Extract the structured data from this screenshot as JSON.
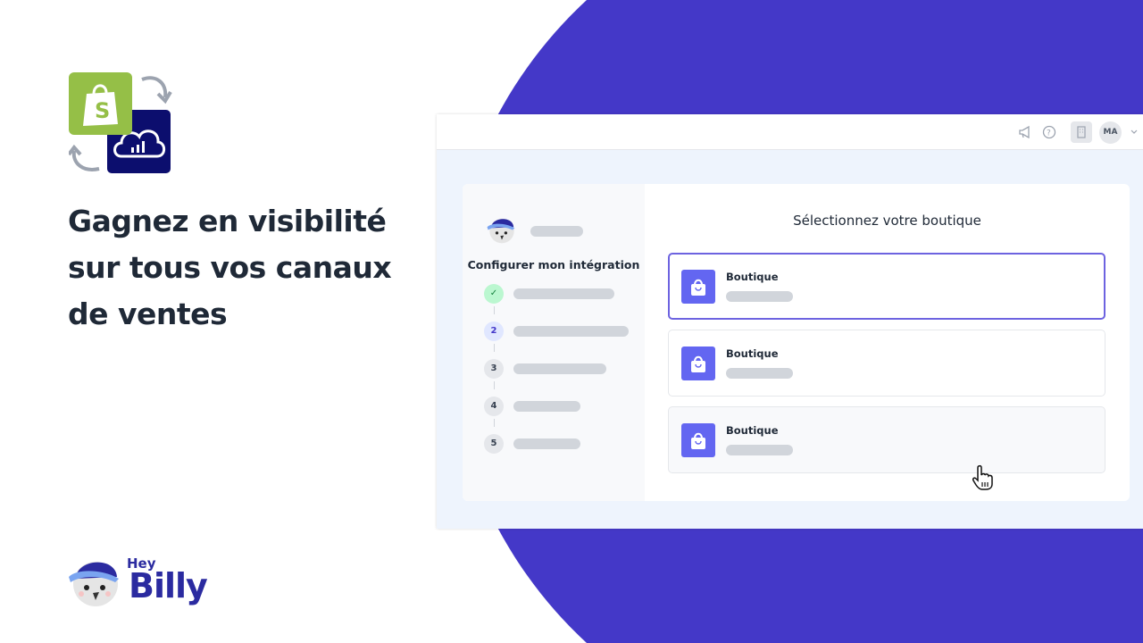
{
  "headline": {
    "line1": "Gagnez en visibilité",
    "line2": "sur tous vos canaux",
    "line3": "de ventes"
  },
  "brand": {
    "hey": "Hey",
    "billy": "Billy"
  },
  "app": {
    "header": {
      "icons": [
        "megaphone-icon",
        "help-icon",
        "building-icon"
      ],
      "avatar_initials": "MA"
    },
    "sidebar": {
      "heading": "Configurer mon intégration",
      "steps": [
        {
          "status": "done",
          "label": "✓"
        },
        {
          "status": "active",
          "label": "2"
        },
        {
          "status": "pending",
          "label": "3"
        },
        {
          "status": "pending",
          "label": "4"
        },
        {
          "status": "pending",
          "label": "5"
        }
      ]
    },
    "main": {
      "title": "Sélectionnez votre boutique",
      "shops": [
        {
          "name": "Boutique",
          "state": "selected"
        },
        {
          "name": "Boutique",
          "state": "default"
        },
        {
          "name": "Boutique",
          "state": "hover"
        }
      ]
    }
  },
  "colors": {
    "accent": "#4438c8",
    "shop_icon": "#6366f1",
    "shopify": "#95bf47",
    "brand_text": "#2b2ba0"
  }
}
